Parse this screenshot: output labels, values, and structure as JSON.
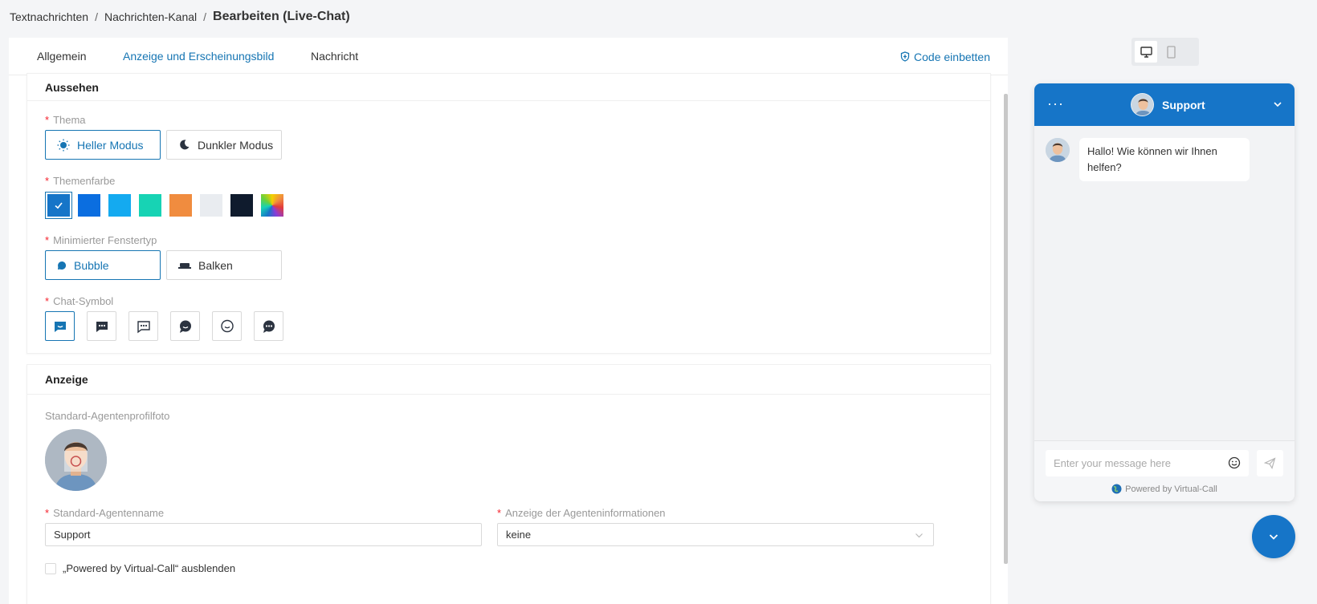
{
  "breadcrumb": {
    "items": [
      "Textnachrichten",
      "Nachrichten-Kanal"
    ],
    "separator": "/",
    "current": "Bearbeiten (Live-Chat)"
  },
  "tabs": [
    {
      "label": "Allgemein",
      "active": false
    },
    {
      "label": "Anzeige und Erscheinungsbild",
      "active": true
    },
    {
      "label": "Nachricht",
      "active": false
    }
  ],
  "embed_code": {
    "label": "Code einbetten",
    "icon": "shield-icon"
  },
  "appearance": {
    "title": "Aussehen",
    "theme": {
      "label": "Thema",
      "options": [
        {
          "label": "Heller Modus",
          "icon": "sun-icon",
          "selected": true
        },
        {
          "label": "Dunkler Modus",
          "icon": "moon-icon",
          "selected": false
        }
      ]
    },
    "theme_color": {
      "label": "Themenfarbe",
      "swatches": [
        {
          "color": "#1675c8",
          "selected": true
        },
        {
          "color": "#0b6ee0",
          "selected": false
        },
        {
          "color": "#14aaf0",
          "selected": false
        },
        {
          "color": "#17d3b4",
          "selected": false
        },
        {
          "color": "#f08c3f",
          "selected": false
        },
        {
          "color": "#e9ecf0",
          "selected": false
        },
        {
          "color": "#0f1b2d",
          "selected": false
        },
        {
          "color": "gradient",
          "selected": false
        }
      ]
    },
    "minimized_type": {
      "label": "Minimierter Fenstertyp",
      "options": [
        {
          "label": "Bubble",
          "icon": "bubble-icon",
          "selected": true
        },
        {
          "label": "Balken",
          "icon": "bar-icon",
          "selected": false
        }
      ]
    },
    "chat_symbol": {
      "label": "Chat-Symbol",
      "options": [
        {
          "icon": "chat-smile-square-icon",
          "selected": true
        },
        {
          "icon": "chat-dots-filled-icon",
          "selected": false
        },
        {
          "icon": "chat-dots-outline-icon",
          "selected": false
        },
        {
          "icon": "chat-round-filled-icon",
          "selected": false
        },
        {
          "icon": "chat-smile-round-icon",
          "selected": false
        },
        {
          "icon": "chat-round-dots-icon",
          "selected": false
        }
      ]
    }
  },
  "display": {
    "title": "Anzeige",
    "profile_photo_label": "Standard-Agentenprofilfoto",
    "agent_name": {
      "label": "Standard-Agentenname",
      "value": "Support"
    },
    "agent_info": {
      "label": "Anzeige der Agenteninformationen",
      "value": "keine"
    },
    "hide_powered_by": {
      "label": "„Powered by Virtual-Call“ ausblenden",
      "checked": false
    }
  },
  "preview": {
    "device_toggle": [
      {
        "icon": "desktop-icon",
        "selected": true
      },
      {
        "icon": "mobile-icon",
        "selected": false
      }
    ],
    "header": {
      "agent_name": "Support",
      "menu_icon": "more-dots-icon",
      "collapse_icon": "chevron-down-icon"
    },
    "greeting": "Hallo! Wie können wir Ihnen helfen?",
    "input_placeholder": "Enter your message here",
    "powered_by": "Powered by Virtual-Call",
    "accent": "#1675c8"
  }
}
